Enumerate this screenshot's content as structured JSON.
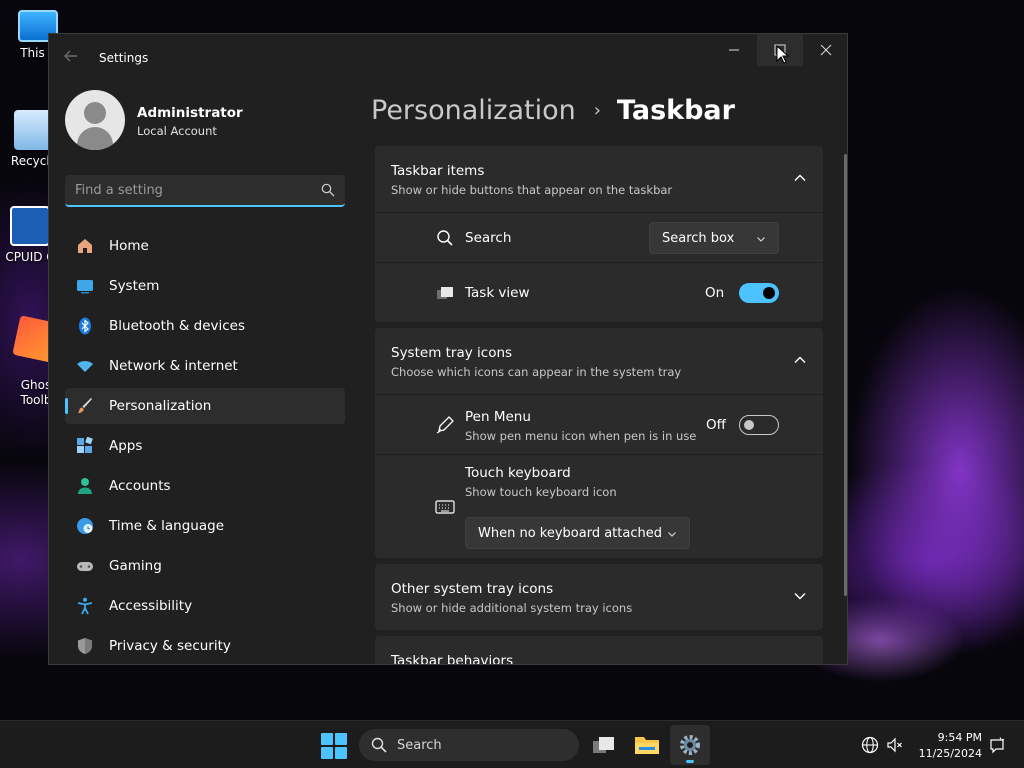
{
  "desktop": {
    "icons": [
      {
        "label": "This P"
      },
      {
        "label": "Recycle"
      },
      {
        "label": "CPUID C"
      },
      {
        "label": "Ghos\nToolb"
      }
    ]
  },
  "window": {
    "title": "Settings",
    "controls": {
      "minimize": "─",
      "maximize": "☐",
      "close": "✕"
    }
  },
  "profile": {
    "name": "Administrator",
    "account_type": "Local Account"
  },
  "search": {
    "placeholder": "Find a setting"
  },
  "sidebar": {
    "items": [
      {
        "label": "Home",
        "icon": "home-icon"
      },
      {
        "label": "System",
        "icon": "system-icon"
      },
      {
        "label": "Bluetooth & devices",
        "icon": "bluetooth-icon"
      },
      {
        "label": "Network & internet",
        "icon": "wifi-icon"
      },
      {
        "label": "Personalization",
        "icon": "brush-icon",
        "selected": true
      },
      {
        "label": "Apps",
        "icon": "apps-icon"
      },
      {
        "label": "Accounts",
        "icon": "accounts-icon"
      },
      {
        "label": "Time & language",
        "icon": "globe-clock-icon"
      },
      {
        "label": "Gaming",
        "icon": "gamepad-icon"
      },
      {
        "label": "Accessibility",
        "icon": "accessibility-icon"
      },
      {
        "label": "Privacy & security",
        "icon": "shield-icon"
      }
    ]
  },
  "breadcrumb": {
    "parent": "Personalization",
    "separator": "›",
    "current": "Taskbar"
  },
  "sections": {
    "taskbar_items": {
      "title": "Taskbar items",
      "description": "Show or hide buttons that appear on the taskbar",
      "search": {
        "label": "Search",
        "value": "Search box"
      },
      "task_view": {
        "label": "Task view",
        "state": "On"
      }
    },
    "system_tray": {
      "title": "System tray icons",
      "description": "Choose which icons can appear in the system tray",
      "pen_menu": {
        "label": "Pen Menu",
        "description": "Show pen menu icon when pen is in use",
        "state": "Off"
      },
      "touch_keyboard": {
        "label": "Touch keyboard",
        "description": "Show touch keyboard icon",
        "value": "When no keyboard attached"
      }
    },
    "other_tray": {
      "title": "Other system tray icons",
      "description": "Show or hide additional system tray icons"
    },
    "behaviors": {
      "title": "Taskbar behaviors"
    }
  },
  "taskbar": {
    "search_label": "Search",
    "time": "9:54 PM",
    "date": "11/25/2024"
  },
  "colors": {
    "accent": "#4cc2ff",
    "window_bg": "#202020",
    "card_bg": "#2b2b2b"
  }
}
